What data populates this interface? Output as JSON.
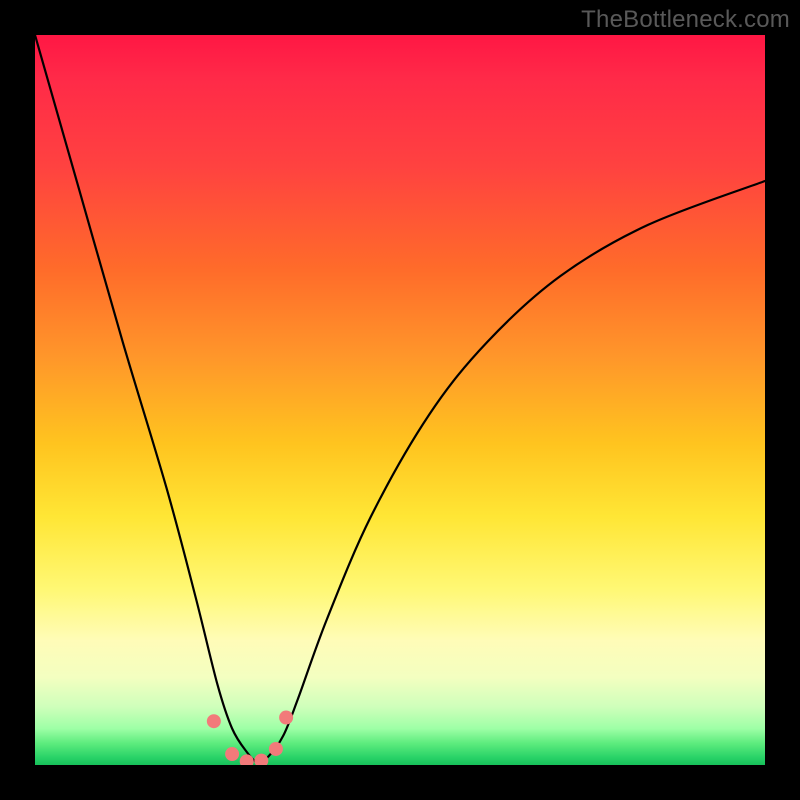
{
  "watermark": "TheBottleneck.com",
  "colors": {
    "frame": "#000000",
    "curve": "#000000",
    "dot_fill": "#f27a7a",
    "dot_stroke": "#c25a5a"
  },
  "chart_data": {
    "type": "line",
    "title": "",
    "xlabel": "",
    "ylabel": "",
    "xlim": [
      0,
      100
    ],
    "ylim": [
      0,
      100
    ],
    "grid": false,
    "series": [
      {
        "name": "bottleneck-curve",
        "x": [
          0,
          6,
          12,
          18,
          22,
          25,
          27,
          29,
          30.5,
          32,
          34,
          36,
          40,
          46,
          54,
          62,
          72,
          84,
          100
        ],
        "y": [
          100,
          79,
          58,
          38,
          23,
          11,
          5,
          1.8,
          0.4,
          1.2,
          4,
          9,
          20,
          34,
          48,
          58,
          67,
          74,
          80
        ]
      }
    ],
    "annotations": {
      "dots_x": [
        24.5,
        27,
        29,
        31,
        33,
        34.4
      ],
      "dots_y": [
        6,
        1.5,
        0.5,
        0.6,
        2.2,
        6.5
      ]
    }
  }
}
